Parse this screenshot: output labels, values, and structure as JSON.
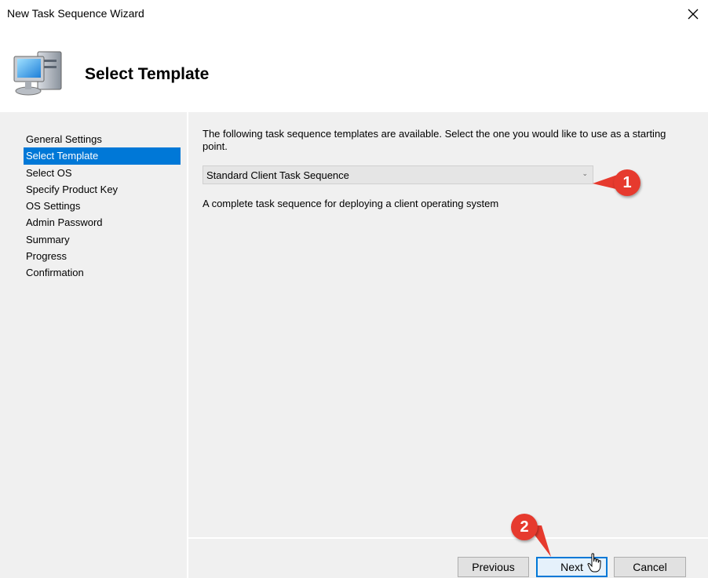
{
  "window": {
    "title": "New Task Sequence Wizard"
  },
  "header": {
    "title": "Select Template",
    "icon": "computer-icon"
  },
  "sidebar": {
    "items": [
      {
        "label": "General Settings",
        "selected": false
      },
      {
        "label": "Select Template",
        "selected": true
      },
      {
        "label": "Select OS",
        "selected": false
      },
      {
        "label": "Specify Product Key",
        "selected": false
      },
      {
        "label": "OS Settings",
        "selected": false
      },
      {
        "label": "Admin Password",
        "selected": false
      },
      {
        "label": "Summary",
        "selected": false
      },
      {
        "label": "Progress",
        "selected": false
      },
      {
        "label": "Confirmation",
        "selected": false
      }
    ]
  },
  "main": {
    "intro": "The following task sequence templates are available.  Select the one you would like to use as a starting point.",
    "template_select": {
      "value": "Standard Client Task Sequence"
    },
    "description": "A complete task sequence for deploying a client operating system"
  },
  "footer": {
    "previous_label": "Previous",
    "next_label": "Next",
    "cancel_label": "Cancel"
  },
  "annotations": {
    "badge1": "1",
    "badge2": "2"
  },
  "colors": {
    "selection": "#0078d7",
    "badge": "#e63a2e",
    "panel": "#f0f0f0"
  }
}
